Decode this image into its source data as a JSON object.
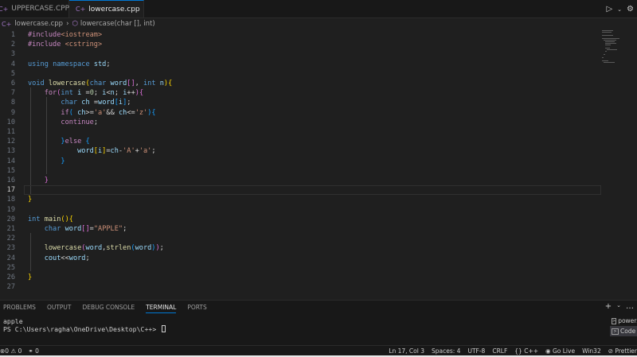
{
  "tabs": [
    {
      "label": "UPPERCASE.CPP",
      "active": false
    },
    {
      "label": "lowercase.cpp",
      "active": true,
      "dirty": true
    }
  ],
  "breadcrumb": {
    "file": "lowercase.cpp",
    "symbol": "lowercase(char [], int)"
  },
  "editor": {
    "current_line": 17,
    "lines": [
      {
        "n": "1",
        "text": "#include<iostream>"
      },
      {
        "n": "2",
        "text": "#include <cstring>"
      },
      {
        "n": "3",
        "text": ""
      },
      {
        "n": "4",
        "text": "using namespace std;"
      },
      {
        "n": "5",
        "text": ""
      },
      {
        "n": "6",
        "text": "void lowercase(char word[], int n){"
      },
      {
        "n": "7",
        "text": "    for(int i =0; i<n; i++){"
      },
      {
        "n": "8",
        "text": "        char ch =word[i];"
      },
      {
        "n": "9",
        "text": "        if( ch>='a'&& ch<='z'){"
      },
      {
        "n": "10",
        "text": "        continue;"
      },
      {
        "n": "11",
        "text": ""
      },
      {
        "n": "12",
        "text": "        }else {"
      },
      {
        "n": "13",
        "text": "            word[i]=ch-'A'+'a';"
      },
      {
        "n": "14",
        "text": "        }"
      },
      {
        "n": "15",
        "text": ""
      },
      {
        "n": "16",
        "text": "    }"
      },
      {
        "n": "17",
        "text": ""
      },
      {
        "n": "18",
        "text": "}"
      },
      {
        "n": "19",
        "text": ""
      },
      {
        "n": "20",
        "text": "int main(){"
      },
      {
        "n": "21",
        "text": "    char word[]=\"APPLE\";"
      },
      {
        "n": "22",
        "text": ""
      },
      {
        "n": "23",
        "text": "    lowercase(word,strlen(word));"
      },
      {
        "n": "24",
        "text": "    cout<<word;"
      },
      {
        "n": "25",
        "text": ""
      },
      {
        "n": "26",
        "text": "}"
      },
      {
        "n": "27",
        "text": ""
      }
    ]
  },
  "panel": {
    "tabs": [
      "PROBLEMS",
      "OUTPUT",
      "DEBUG CONSOLE",
      "TERMINAL",
      "PORTS"
    ],
    "active_tab": "TERMINAL",
    "terminal_output": "apple",
    "prompt": "PS C:\\Users\\ragha\\OneDrive\\Desktop\\C++> ",
    "terminals": [
      "powershell",
      "Code"
    ]
  },
  "status": {
    "errors": "0",
    "warnings": "0",
    "ports": "0",
    "position": "Ln 17, Col 3",
    "spaces": "Spaces: 4",
    "encoding": "UTF-8",
    "eol": "CRLF",
    "language": "C++",
    "golive": "Go Live",
    "platform": "Win32",
    "prettier": "Prettier"
  }
}
